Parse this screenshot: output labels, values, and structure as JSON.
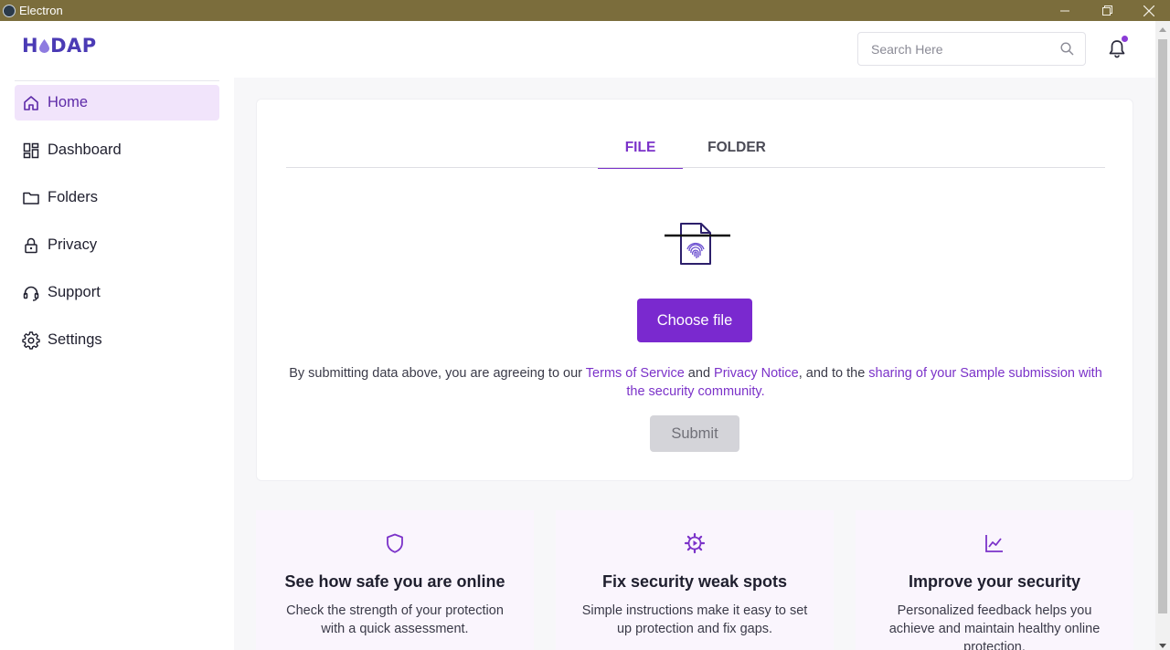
{
  "window": {
    "title": "Electron",
    "title_bar_color": "#7b6d3c"
  },
  "header": {
    "logo_text_left": "H",
    "logo_text_right": "DAP",
    "search_placeholder": "Search Here",
    "has_notification": true
  },
  "sidebar": {
    "items": [
      {
        "label": "Home",
        "icon": "home-icon",
        "active": true
      },
      {
        "label": "Dashboard",
        "icon": "dashboard-icon",
        "active": false
      },
      {
        "label": "Folders",
        "icon": "folder-icon",
        "active": false
      },
      {
        "label": "Privacy",
        "icon": "lock-icon",
        "active": false
      },
      {
        "label": "Support",
        "icon": "headset-icon",
        "active": false
      },
      {
        "label": "Settings",
        "icon": "gear-icon",
        "active": false
      }
    ]
  },
  "upload": {
    "tabs": [
      {
        "label": "FILE",
        "active": true
      },
      {
        "label": "FOLDER",
        "active": false
      }
    ],
    "choose_label": "Choose file",
    "terms": {
      "prefix": "By submitting data above, you are agreeing to our ",
      "tos_link": "Terms of Service",
      "and": " and ",
      "privacy_link": "Privacy Notice",
      "middle": ", and to the ",
      "sharing_link": "sharing of your Sample submission with the security community."
    },
    "submit_label": "Submit"
  },
  "features": [
    {
      "icon": "shield-icon",
      "title": "See how safe you are online",
      "desc": "Check the strength of your protection with a quick assessment."
    },
    {
      "icon": "gear-icon",
      "title": "Fix security weak spots",
      "desc": "Simple instructions make it easy to set up protection and fix gaps."
    },
    {
      "icon": "chart-line-icon",
      "title": "Improve your security",
      "desc": "Personalized feedback helps you achieve and maintain healthy online protection."
    }
  ],
  "colors": {
    "accent": "#7a29cf",
    "active_bg": "#f1e4fb",
    "logo": "#4b3bb5"
  }
}
